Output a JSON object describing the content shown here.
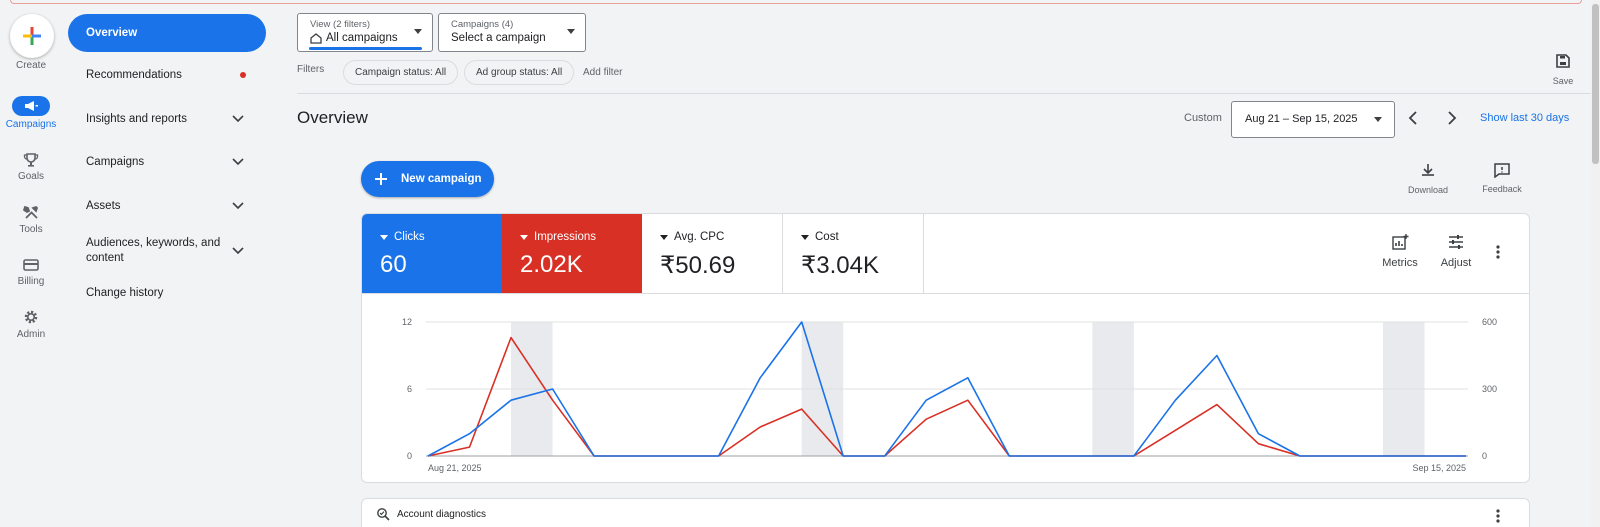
{
  "rail": {
    "create": "Create",
    "items": [
      {
        "label": "Campaigns",
        "icon": "megaphone-icon",
        "active": true
      },
      {
        "label": "Goals",
        "icon": "trophy-icon"
      },
      {
        "label": "Tools",
        "icon": "tools-icon"
      },
      {
        "label": "Billing",
        "icon": "credit-card-icon"
      },
      {
        "label": "Admin",
        "icon": "gear-icon"
      }
    ]
  },
  "nav": {
    "items": [
      {
        "label": "Overview",
        "active": true
      },
      {
        "label": "Recommendations",
        "dot": true
      },
      {
        "label": "Insights and reports",
        "chevron": true
      },
      {
        "label": "Campaigns",
        "chevron": true
      },
      {
        "label": "Assets",
        "chevron": true
      },
      {
        "label": "Audiences, keywords, and content",
        "chevron": true
      },
      {
        "label": "Change history"
      }
    ]
  },
  "view_selector": {
    "small": "View (2 filters)",
    "value": "All campaigns"
  },
  "campaign_selector": {
    "small": "Campaigns (4)",
    "value": "Select a campaign"
  },
  "filters": {
    "label": "Filters",
    "chips": [
      "Campaign status: All",
      "Ad group status: All"
    ],
    "add": "Add filter"
  },
  "save": "Save",
  "page_title": "Overview",
  "date": {
    "custom": "Custom",
    "range": "Aug 21 – Sep 15, 2025",
    "show_last": "Show last 30 days"
  },
  "new_campaign": "New campaign",
  "download": "Download",
  "feedback": "Feedback",
  "metrics": [
    {
      "label": "Clicks",
      "value": "60",
      "bg": "#1a73e8",
      "fg": "#ffffff"
    },
    {
      "label": "Impressions",
      "value": "2.02K",
      "bg": "#d93025",
      "fg": "#ffffff"
    },
    {
      "label": "Avg. CPC",
      "value": "₹50.69",
      "bg": "#ffffff",
      "fg": "#202124"
    },
    {
      "label": "Cost",
      "value": "₹3.04K",
      "bg": "#ffffff",
      "fg": "#202124"
    }
  ],
  "metrics_btn": "Metrics",
  "adjust_btn": "Adjust",
  "account_diagnostics": "Account diagnostics",
  "chart_data": {
    "type": "line",
    "x_start": "Aug 21, 2025",
    "x_end": "Sep 15, 2025",
    "left_ticks": [
      "12",
      "6",
      "0"
    ],
    "right_ticks": [
      "600",
      "300",
      "0"
    ],
    "ylim_left": [
      0,
      12
    ],
    "ylim_right": [
      0,
      600
    ],
    "weekend_bands": [
      [
        2,
        3
      ],
      [
        9,
        10
      ],
      [
        16,
        17
      ],
      [
        23,
        24
      ]
    ],
    "series": [
      {
        "name": "Clicks",
        "color": "#1a73e8",
        "axis": "left",
        "values": [
          0,
          2,
          5,
          6,
          0,
          0,
          0,
          0,
          7,
          12,
          0,
          0,
          5,
          7,
          0,
          0,
          0,
          0,
          5,
          9,
          2,
          0,
          0,
          0,
          0,
          0
        ]
      },
      {
        "name": "Impressions",
        "color": "#d93025",
        "axis": "right",
        "values": [
          0,
          40,
          530,
          250,
          0,
          0,
          0,
          0,
          130,
          210,
          0,
          0,
          165,
          250,
          0,
          0,
          0,
          0,
          115,
          230,
          55,
          0,
          0,
          0,
          0,
          0
        ]
      }
    ]
  }
}
